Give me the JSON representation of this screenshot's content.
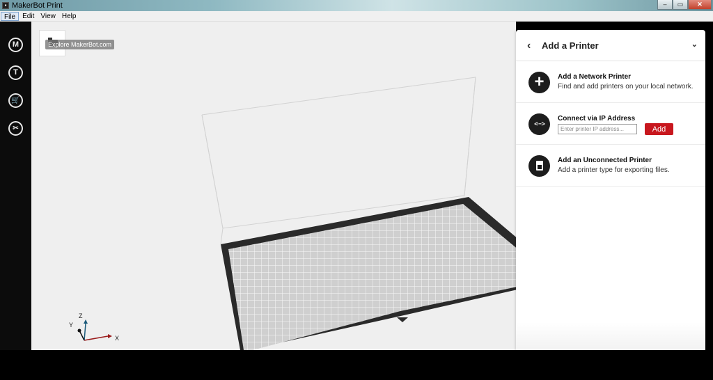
{
  "window": {
    "title": "MakerBot Print",
    "minimize": "–",
    "maximize": "▭",
    "close": "✕"
  },
  "menu": {
    "items": [
      "File",
      "Edit",
      "View",
      "Help"
    ]
  },
  "sidebar": {
    "items": [
      {
        "name": "makerbot-logo",
        "glyph": "M"
      },
      {
        "name": "thingiverse",
        "glyph": "T"
      },
      {
        "name": "store",
        "glyph": "🛒"
      },
      {
        "name": "tools",
        "glyph": "✂"
      }
    ]
  },
  "viewport": {
    "tooltip": "Explore MakerBot.com",
    "axes": {
      "x": "X",
      "y": "Y",
      "z": "Z"
    }
  },
  "panel": {
    "back_glyph": "‹",
    "title": "Add a Printer",
    "collapse_glyph": "⌄",
    "network": {
      "title": "Add a Network Printer",
      "desc": "Find and add printers on your local network."
    },
    "ip": {
      "title": "Connect via IP Address",
      "placeholder": "Enter printer IP address...",
      "button": "Add"
    },
    "unconnected": {
      "title": "Add an Unconnected Printer",
      "desc": "Add a printer type for exporting files."
    }
  },
  "colors": {
    "accent": "#c8171e",
    "sidebar": "#0c0c0c",
    "viewport": "#efefef"
  }
}
